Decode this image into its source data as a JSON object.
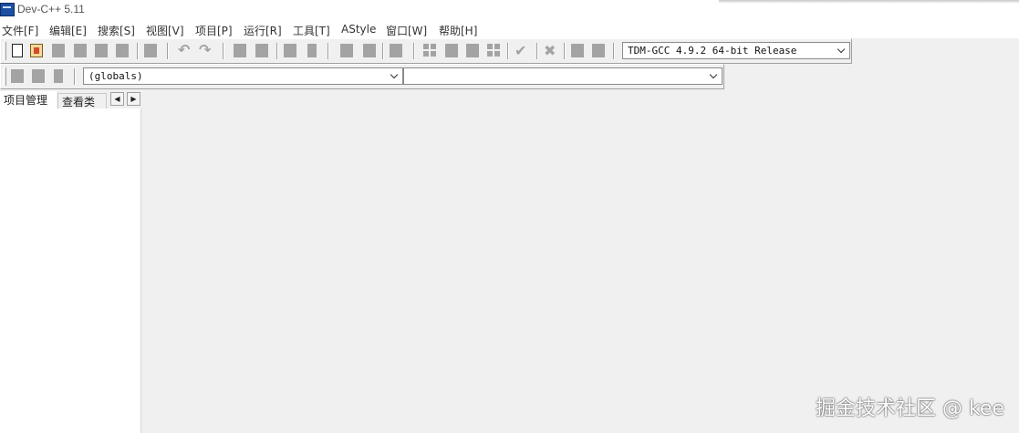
{
  "window": {
    "title": "Dev-C++ 5.11",
    "app_icon": "devcpp-icon"
  },
  "menubar": {
    "items": [
      "文件[F]",
      "编辑[E]",
      "搜索[S]",
      "视图[V]",
      "项目[P]",
      "运行[R]",
      "工具[T]",
      "AStyle",
      "窗口[W]",
      "帮助[H]"
    ]
  },
  "toolbar": {
    "compiler_select": "TDM-GCC 4.9.2 64-bit Release"
  },
  "toolbar2": {
    "scope_select": "(globals)",
    "member_select": ""
  },
  "left_panel": {
    "tabs": [
      "项目管理",
      "查看类"
    ],
    "active_tab": 0
  },
  "watermark": "掘金技术社区 @ kee"
}
